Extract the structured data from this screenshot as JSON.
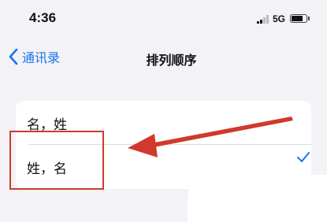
{
  "status_bar": {
    "time": "4:36",
    "network": "5G",
    "signal_icon": "cellular-signal-icon",
    "battery_icon": "battery-icon",
    "battery_level": 0.75
  },
  "nav": {
    "back_label": "通讯录",
    "back_icon": "chevron-left-icon",
    "title": "排列顺序",
    "accent_color": "#1a73e8"
  },
  "options": [
    {
      "label": "名，姓",
      "selected": false
    },
    {
      "label": "姓，名",
      "selected": true
    }
  ],
  "check_icon": "checkmark-icon",
  "annotation": {
    "color": "#d0392b",
    "arrow_icon": "red-arrow-icon",
    "highlight": "highlight-box"
  }
}
